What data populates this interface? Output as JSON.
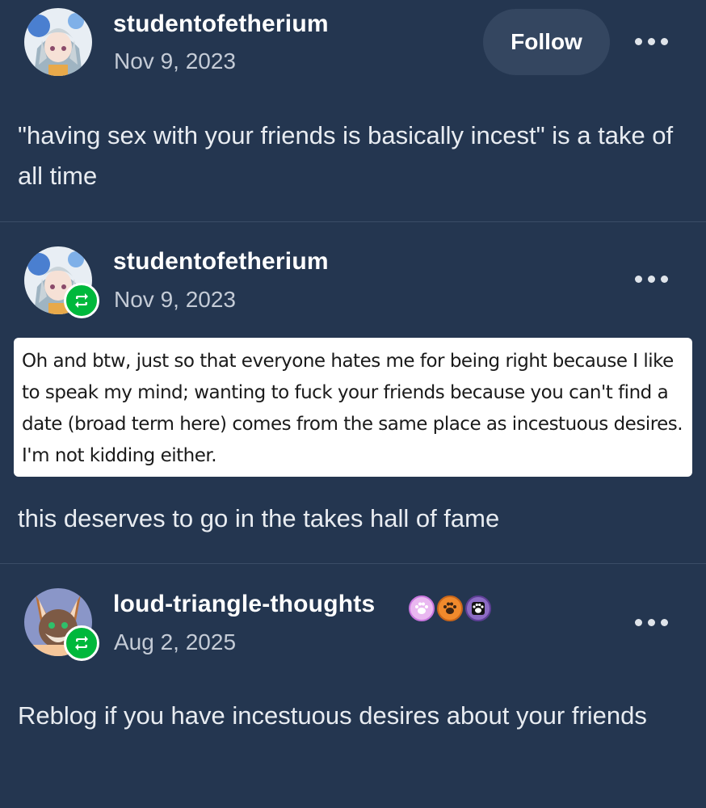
{
  "posts": [
    {
      "username": "studentofetherium",
      "date": "Nov 9, 2023",
      "follow_label": "Follow",
      "text": "\"having sex with your friends is basically incest\" is a take of all time"
    },
    {
      "username": "studentofetherium",
      "date": "Nov 9, 2023",
      "quote_text": "Oh and btw, just so that everyone hates me for being right because I like to speak my mind; wanting to fuck your friends because you can't find a date (broad term here) comes from the same place as incestuous desires. I'm not kidding either.",
      "text": "this deserves to go in the takes hall of fame"
    },
    {
      "username": "loud-triangle-thoughts",
      "date": "Aug 2, 2025",
      "badges": [
        "paw-badge-pink",
        "paw-badge-orange",
        "paw-badge-purple"
      ],
      "text": "Reblog if you have incestuous desires about your friends"
    }
  ],
  "icons": {
    "reblog": "reblog-icon",
    "more": "more-options-icon"
  },
  "colors": {
    "background": "#243650",
    "reblog_green": "#00b83c",
    "follow_bg": "#344660"
  }
}
